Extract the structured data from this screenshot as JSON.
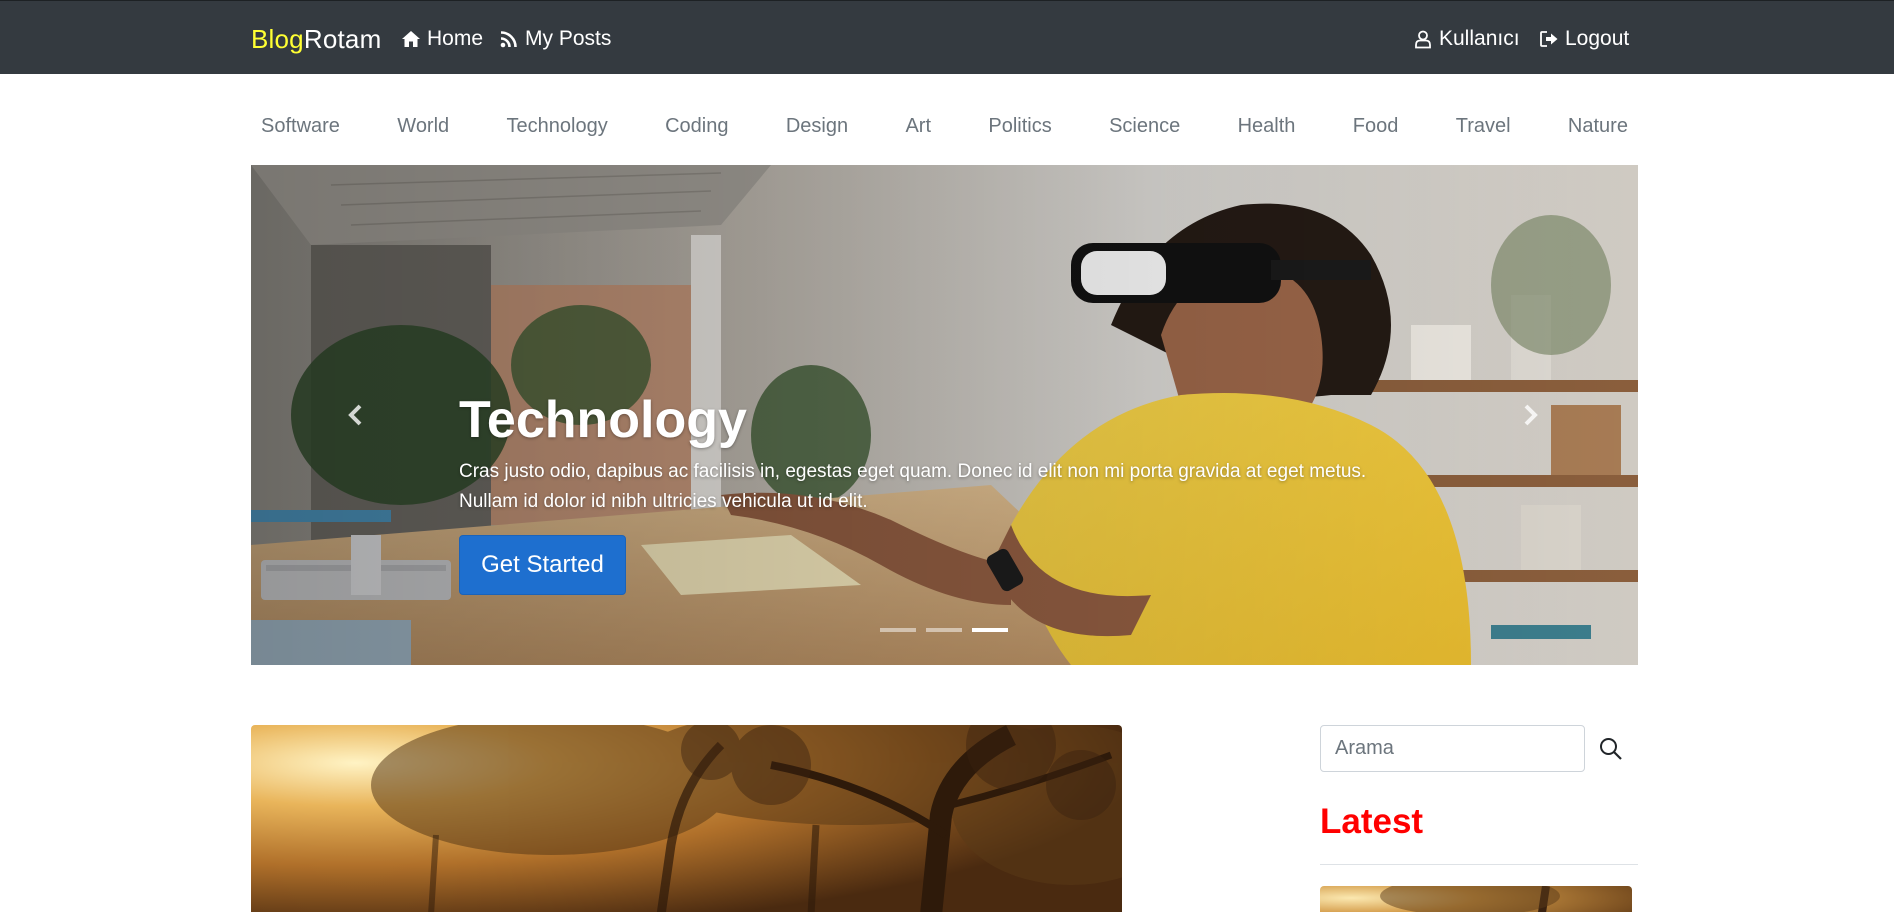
{
  "navbar": {
    "brand_part1": "Blog",
    "brand_part2": "Rotam",
    "home": "Home",
    "my_posts": "My Posts",
    "user": "Kullanıcı",
    "logout": "Logout",
    "icons": [
      "home-icon",
      "rss-icon",
      "user-icon",
      "sign-out-icon"
    ]
  },
  "categories": [
    "Software",
    "World",
    "Technology",
    "Coding",
    "Design",
    "Art",
    "Politics",
    "Science",
    "Health",
    "Food",
    "Travel",
    "Nature"
  ],
  "carousel": {
    "title": "Technology",
    "text": "Cras justo odio, dapibus ac facilisis in, egestas eget quam. Donec id elit non mi porta gravida at eget metus. Nullam id dolor id nibh ultricies vehicula ut id elit.",
    "button": "Get Started",
    "slide_count": 3,
    "active_slide": 3
  },
  "sidebar": {
    "search_placeholder": "Arama",
    "latest_heading": "Latest"
  },
  "colors": {
    "navbar_bg": "#343a40",
    "brand_accent": "#ffff33",
    "primary_button": "#1e6fcf",
    "latest_heading": "#ff0000",
    "category_text": "#6c757d"
  }
}
